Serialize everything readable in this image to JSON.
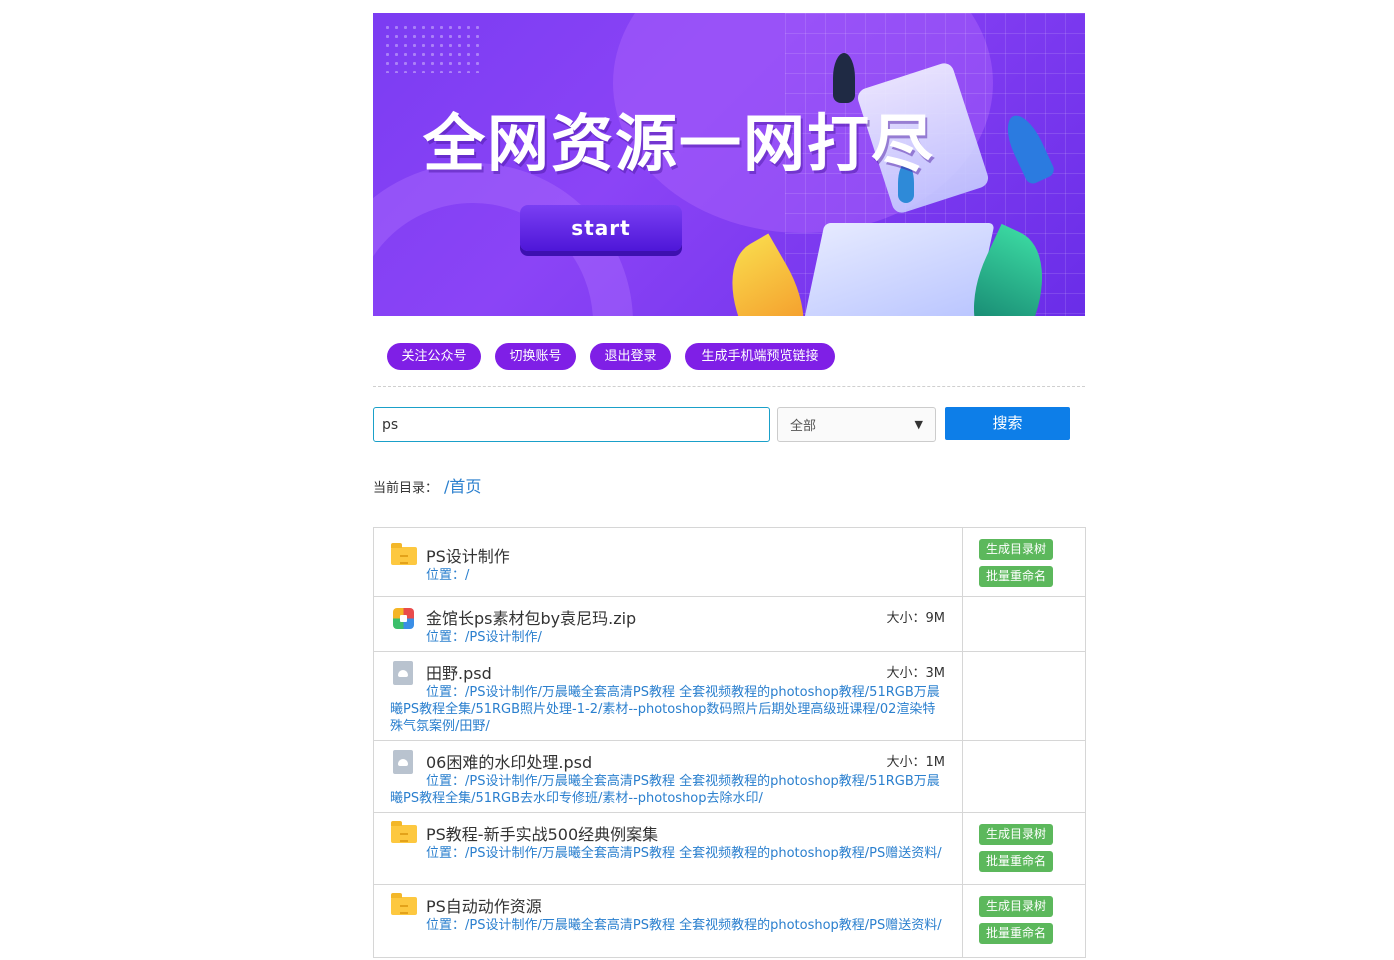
{
  "banner": {
    "title": "全网资源一网打尽",
    "start_label": "start"
  },
  "actions": {
    "follow_label": "关注公众号",
    "switch_label": "切换账号",
    "logout_label": "退出登录",
    "mobile_link_label": "生成手机端预览链接"
  },
  "search": {
    "value": "ps",
    "scope_selected": "全部",
    "button_label": "搜索"
  },
  "breadcrumb": {
    "label": "当前目录：",
    "path": "/首页"
  },
  "table": {
    "location_prefix": "位置：",
    "size_prefix": "大小：",
    "tree_label": "生成目录树",
    "rename_label": "批量重命名",
    "rows": [
      {
        "type": "folder",
        "name": "PS设计制作",
        "location": "/",
        "size": ""
      },
      {
        "type": "zip",
        "name": "金馆长ps素材包by袁尼玛.zip",
        "location": "/PS设计制作/",
        "size": "9M"
      },
      {
        "type": "psd",
        "name": "田野.psd",
        "location": "/PS设计制作/万晨曦全套高清PS教程 全套视频教程的photoshop教程/51RGB万晨曦PS教程全集/51RGB照片处理-1-2/素材--photoshop数码照片后期处理高级班课程/02渲染特殊气氛案例/田野/",
        "size": "3M"
      },
      {
        "type": "psd",
        "name": "06困难的水印处理.psd",
        "location": "/PS设计制作/万晨曦全套高清PS教程 全套视频教程的photoshop教程/51RGB万晨曦PS教程全集/51RGB去水印专修班/素材--photoshop去除水印/",
        "size": "1M"
      },
      {
        "type": "folder",
        "name": "PS教程-新手实战500经典例案集",
        "location": "/PS设计制作/万晨曦全套高清PS教程 全套视频教程的photoshop教程/PS赠送资料/",
        "size": ""
      },
      {
        "type": "folder",
        "name": "PS自动动作资源",
        "location": "/PS设计制作/万晨曦全套高清PS教程 全套视频教程的photoshop教程/PS赠送资料/",
        "size": ""
      }
    ]
  }
}
